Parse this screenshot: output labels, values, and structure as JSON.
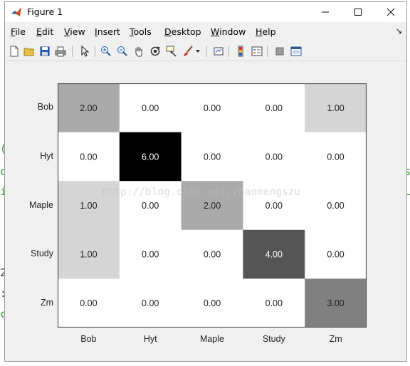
{
  "window": {
    "title": "Figure 1"
  },
  "menu": [
    {
      "key": "F",
      "rest": "ile"
    },
    {
      "key": "E",
      "rest": "dit"
    },
    {
      "key": "V",
      "rest": "iew"
    },
    {
      "key": "I",
      "rest": "nsert"
    },
    {
      "key": "T",
      "rest": "ools"
    },
    {
      "key": "D",
      "rest": "esktop"
    },
    {
      "key": "W",
      "rest": "indow"
    },
    {
      "key": "H",
      "rest": "elp"
    }
  ],
  "toolbar": {
    "icons": [
      "new-figure-icon",
      "open-file-icon",
      "save-icon",
      "print-icon",
      "pointer-icon",
      "zoom-in-icon",
      "zoom-out-icon",
      "pan-hand-icon",
      "rotate-3d-icon",
      "data-cursor-icon",
      "brush-icon",
      "brush-dropdown-icon",
      "link-plot-icon",
      "insert-colorbar-icon",
      "insert-legend-icon",
      "hide-plot-tools-icon",
      "show-plot-tools-icon"
    ]
  },
  "watermark": "http://blog.csdn.net/zhaomengszu",
  "chart_data": {
    "type": "heatmap",
    "colormap": "gray-reversed",
    "row_labels": [
      "Bob",
      "Hyt",
      "Maple",
      "Study",
      "Zm"
    ],
    "col_labels": [
      "Bob",
      "Hyt",
      "Maple",
      "Study",
      "Zm"
    ],
    "values": [
      [
        2,
        0,
        0,
        0,
        1
      ],
      [
        0,
        6,
        0,
        0,
        0
      ],
      [
        1,
        0,
        2,
        0,
        0
      ],
      [
        1,
        0,
        0,
        4,
        0
      ],
      [
        0,
        0,
        0,
        0,
        3
      ]
    ],
    "cell_text": [
      [
        "2.00",
        "0.00",
        "0.00",
        "0.00",
        "1.00"
      ],
      [
        "0.00",
        "6.00",
        "0.00",
        "0.00",
        "0.00"
      ],
      [
        "1.00",
        "0.00",
        "2.00",
        "0.00",
        "0.00"
      ],
      [
        "1.00",
        "0.00",
        "0.00",
        "4.00",
        "0.00"
      ],
      [
        "0.00",
        "0.00",
        "0.00",
        "0.00",
        "3.00"
      ]
    ],
    "vmin": 0,
    "vmax": 6
  }
}
